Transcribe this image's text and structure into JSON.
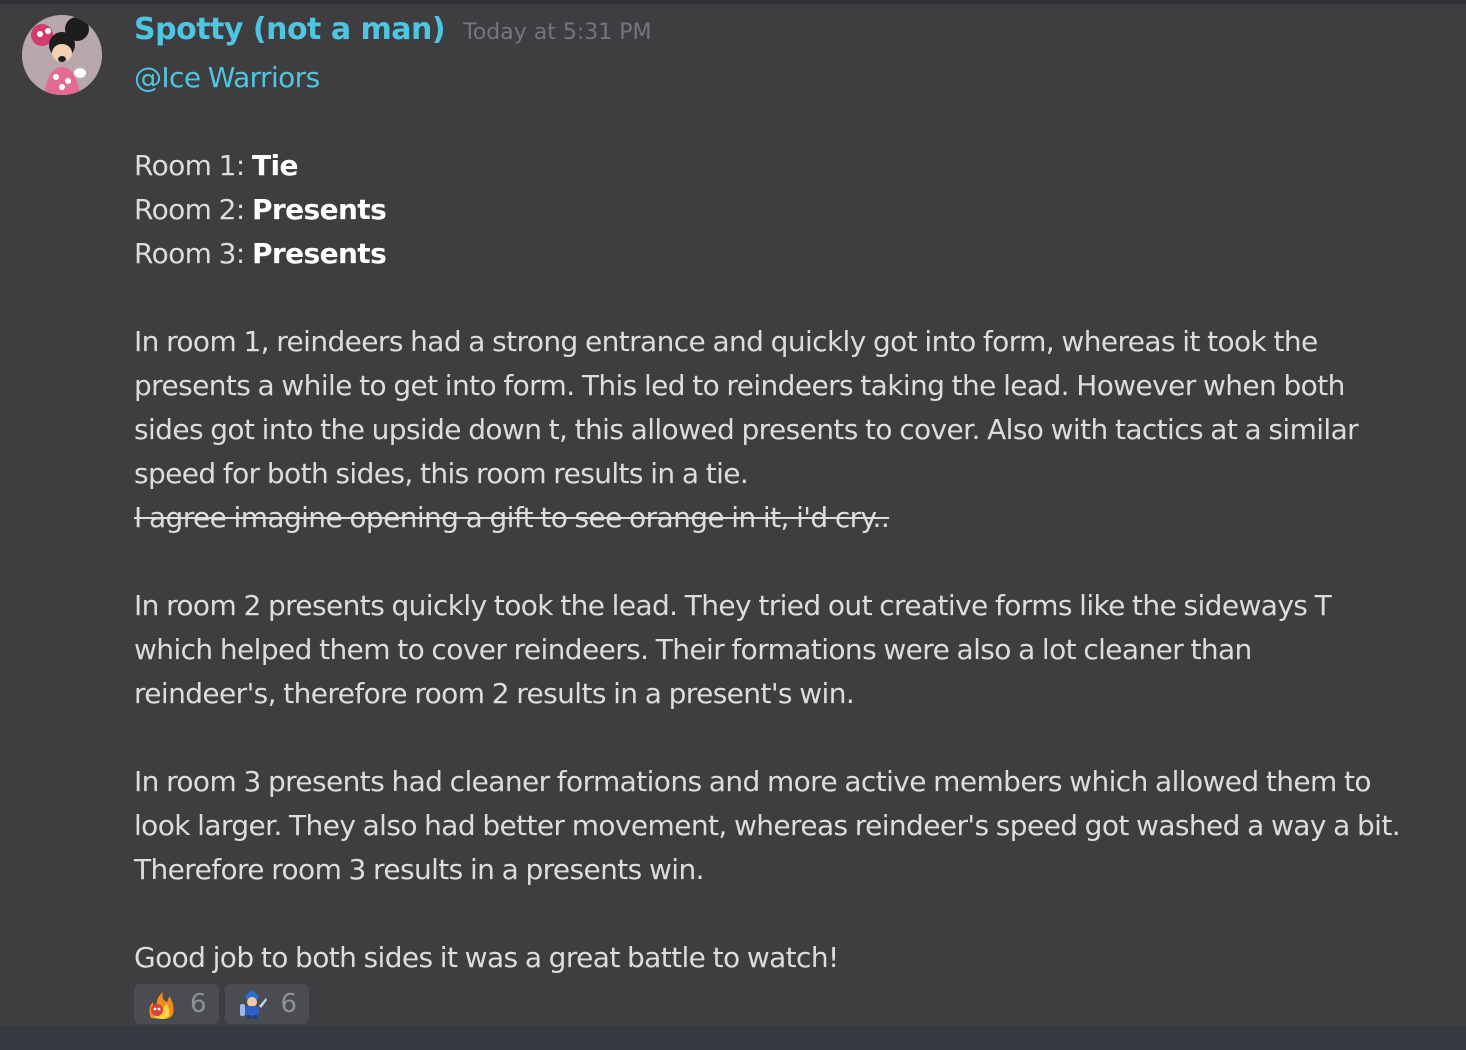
{
  "message": {
    "author": "Spotty (not a man)",
    "timestamp": "Today at 5:31 PM",
    "mention": "@Ice Warriors",
    "results": [
      {
        "label": "Room 1: ",
        "result": "Tie"
      },
      {
        "label": "Room 2: ",
        "result": "Presents"
      },
      {
        "label": "Room 3: ",
        "result": "Presents"
      }
    ],
    "paragraph1": [
      "In room 1, reindeers had a strong entrance and quickly got into form, whereas it took the",
      "presents a while to get into form. This led to reindeers taking the lead. However when both",
      "sides got into the upside down t, this allowed presents to cover. Also with tactics at a similar",
      "speed for both sides, this room results in a tie."
    ],
    "strikethrough": "I agree imagine opening a gift to see orange in it, i'd cry..",
    "paragraph2": [
      "In room 2 presents quickly took the lead. They tried out creative forms like the sideways T",
      "which helped them to cover reindeers. Their formations were also a lot cleaner than",
      "reindeer's, therefore room 2 results in a present's win."
    ],
    "paragraph3": [
      "In room 3 presents had cleaner formations and more active members which allowed them to",
      "look larger. They also had better movement, whereas reindeer's speed got washed a way a bit.",
      "Therefore room 3 results in a presents win."
    ],
    "closing": "Good job to both sides it was a great battle to watch!"
  },
  "reactions": [
    {
      "icon": "fire-character-emoji-icon",
      "count": "6"
    },
    {
      "icon": "blue-warrior-emoji-icon",
      "count": "6"
    }
  ],
  "colors": {
    "background": "#3e3d3f",
    "username": "#4fc6e1",
    "mention": "#4fc6e1",
    "text": "#dcddde",
    "timestamp": "#72767d"
  }
}
